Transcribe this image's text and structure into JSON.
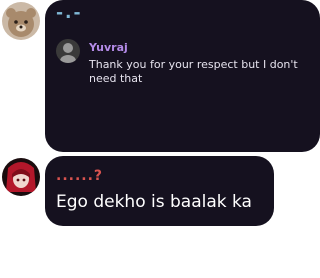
{
  "messages": [
    {
      "sender": "-.-",
      "avatar_icon": "bear-avatar",
      "reply": {
        "name": "Yuvraj",
        "avatar_icon": "user-avatar",
        "text": "Thank you for your respect but I don't need that"
      }
    },
    {
      "sender": "......?",
      "avatar_icon": "anime-avatar",
      "text": "Ego dekho is baalak ka"
    }
  ],
  "colors": {
    "bubble": "#15111f",
    "sender1": "#7fb8d6",
    "reply_name": "#b48be8",
    "sender2": "#d9534f"
  }
}
